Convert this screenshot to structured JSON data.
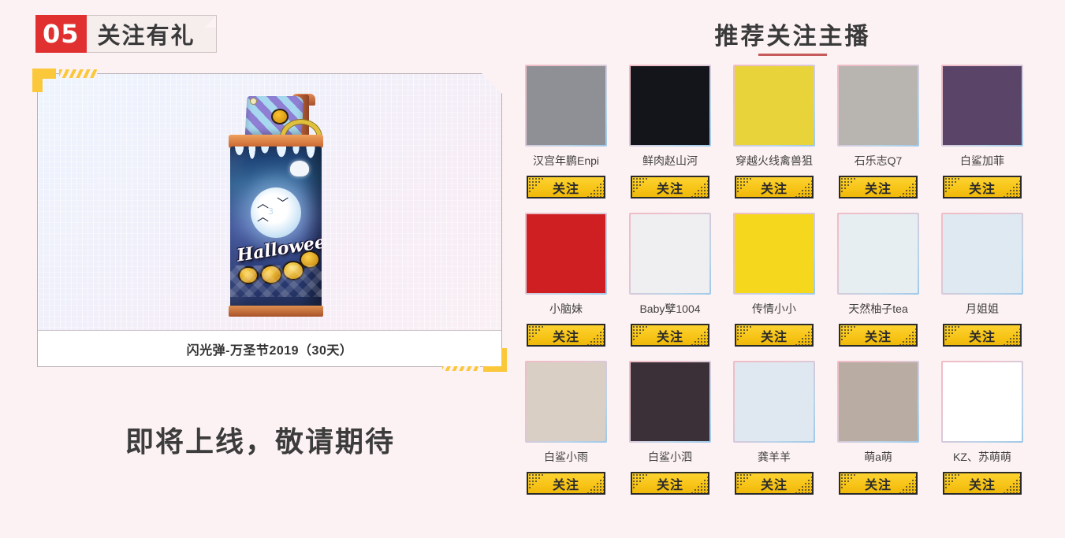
{
  "section": {
    "number": "05",
    "title": "关注有礼"
  },
  "gift": {
    "item_name": "闪光弹-万圣节2019（30天）",
    "artwork_text": "Halloween",
    "artwork_number": "3",
    "coming_soon": "即将上线，敬请期待"
  },
  "recommend": {
    "title": "推荐关注主播",
    "follow_label": "关注",
    "rows": [
      [
        {
          "nick": "汉宫年鹏Enpi",
          "bg": "#8e9095",
          "style": "man-red-jacket"
        },
        {
          "nick": "鲜肉赵山河",
          "bg": "#14151a",
          "style": "man-orange-hair"
        },
        {
          "nick": "穿越火线禽兽狙",
          "bg": "#e8d43a",
          "style": "man-yellow"
        },
        {
          "nick": "石乐志Q7",
          "bg": "#b8b5b0",
          "style": "man-beige-coat"
        },
        {
          "nick": "白鲨加菲",
          "bg": "#5a4468",
          "style": "man-suit-purple"
        }
      ],
      [
        {
          "nick": "小脑妹",
          "bg": "#cf1f23",
          "style": "cartoon-boy-red"
        },
        {
          "nick": "Baby孼1004",
          "bg": "#efeff1",
          "style": "girl-black-dress"
        },
        {
          "nick": "传情小小",
          "bg": "#f5d81e",
          "style": "girl-yellow-bg"
        },
        {
          "nick": "天然柚子tea",
          "bg": "#e6eef2",
          "style": "girl-glasses"
        },
        {
          "nick": "月姐姐",
          "bg": "#dfe9f2",
          "style": "anime-braid"
        }
      ],
      [
        {
          "nick": "白鲨小雨",
          "bg": "#d9cfc4",
          "style": "girl-window"
        },
        {
          "nick": "白鲨小泗",
          "bg": "#3b3038",
          "style": "anime-dark-lady"
        },
        {
          "nick": "龚羊羊",
          "bg": "#dfe8f0",
          "style": "anime-umaru"
        },
        {
          "nick": "萌a萌",
          "bg": "#b9aca2",
          "style": "baby"
        },
        {
          "nick": "KZ、苏萌萌",
          "bg": "#ffffff",
          "style": "anime-pink-girl"
        }
      ]
    ]
  },
  "colors": {
    "page_bg": "#fdf2f3",
    "badge_red": "#e03030",
    "accent_yellow": "#fbc73b",
    "button_yellow": "#f8c519",
    "underline_red": "#c75b5b",
    "text_dark": "#3a3a3a"
  }
}
